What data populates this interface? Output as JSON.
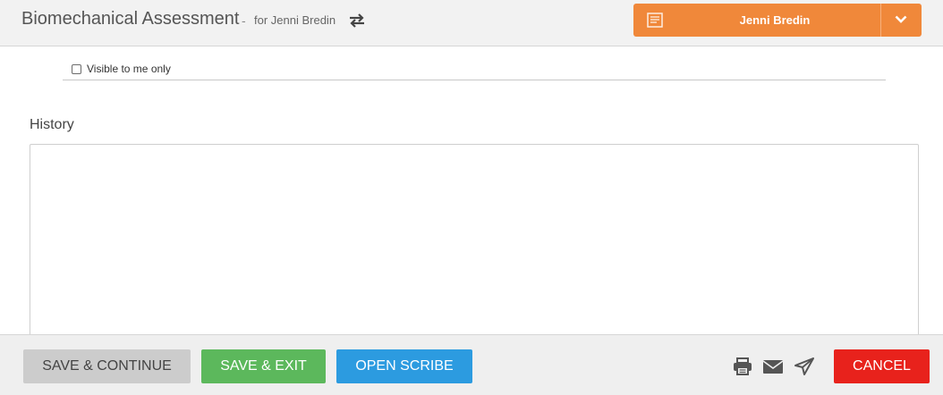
{
  "header": {
    "title": "Biomechanical Assessment",
    "separator": "-",
    "subtitle": "for Jenni Bredin",
    "patient_button": {
      "label": "Jenni Bredin",
      "color": "#f0883a"
    }
  },
  "form": {
    "visible_checkbox": {
      "label": "Visible to me only",
      "checked": false
    },
    "history": {
      "label": "History",
      "value": ""
    }
  },
  "footer": {
    "save_continue": "SAVE & CONTINUE",
    "save_exit": "SAVE & EXIT",
    "open_scribe": "OPEN SCRIBE",
    "cancel": "CANCEL"
  },
  "icons": {
    "swap": "swap-icon",
    "document": "document-icon",
    "caret": "chevron-down-icon",
    "print": "print-icon",
    "mail": "mail-icon",
    "send": "send-icon"
  },
  "colors": {
    "save_exit": "#5cb85c",
    "open_scribe": "#2c9be0",
    "cancel": "#e8221c"
  }
}
